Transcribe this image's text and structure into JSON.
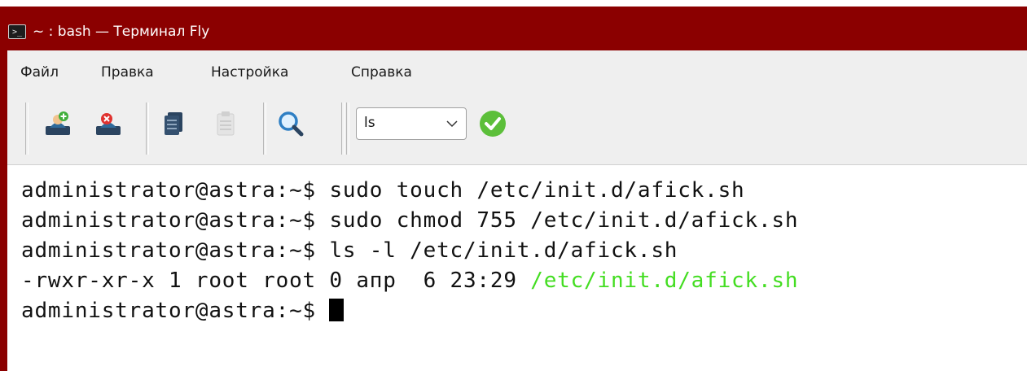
{
  "window": {
    "title": "~ : bash — Терминал Fly",
    "title_icon_glyph": ">_",
    "titlebar_color": "#8b0000"
  },
  "menubar": {
    "items": [
      {
        "label": "Файл"
      },
      {
        "label": "Правка"
      },
      {
        "label": "Настройка"
      },
      {
        "label": "Справка"
      }
    ]
  },
  "toolbar": {
    "buttons": [
      {
        "icon": "new-tab-icon"
      },
      {
        "icon": "close-tab-icon"
      },
      {
        "icon": "copy-icon"
      },
      {
        "icon": "paste-icon"
      },
      {
        "icon": "search-icon"
      }
    ],
    "command_combo": {
      "value": "ls"
    },
    "execute_button": {
      "icon": "checkmark-icon",
      "color": "#5cbf3a"
    }
  },
  "terminal": {
    "lines": [
      {
        "prompt": "administrator@astra:~$",
        "text": " sudo touch /etc/init.d/afick.sh"
      },
      {
        "prompt": "administrator@astra:~$",
        "text": " sudo chmod 755 /etc/init.d/afick.sh"
      },
      {
        "prompt": "administrator@astra:~$",
        "text": " ls -l /etc/init.d/afick.sh"
      },
      {
        "prompt": "-rwxr-xr-x 1 root root 0 апр  6 23:29 ",
        "text": "/etc/init.d/afick.sh"
      },
      {
        "prompt": "administrator@astra:~$",
        "text": " "
      }
    ],
    "highlight_color": "#44dd22"
  }
}
